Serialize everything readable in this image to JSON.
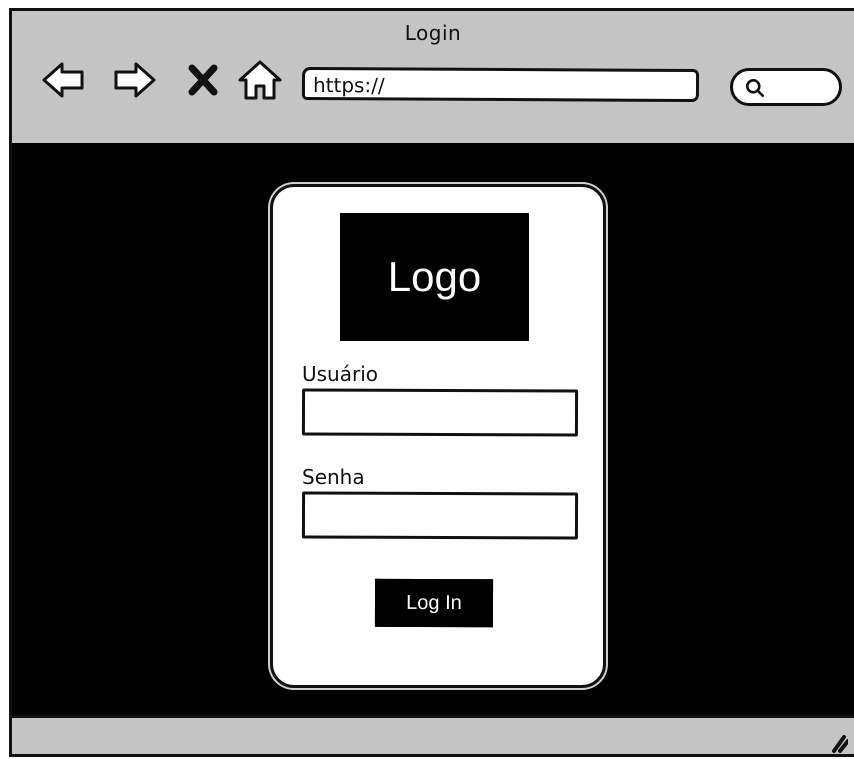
{
  "window": {
    "title": "Login"
  },
  "toolbar": {
    "buttons": [
      {
        "icon": "back-arrow-icon"
      },
      {
        "icon": "forward-arrow-icon"
      },
      {
        "icon": "close-icon"
      },
      {
        "icon": "home-icon"
      }
    ],
    "url_text": "https://",
    "search_icon": "search-icon"
  },
  "login": {
    "logo_text": "Logo",
    "username_label": "Usuário",
    "password_label": "Senha",
    "login_button": "Log In"
  },
  "colors": {
    "chrome": "#c4c4c4",
    "content_background": "#000000",
    "card_background": "#ffffff"
  }
}
